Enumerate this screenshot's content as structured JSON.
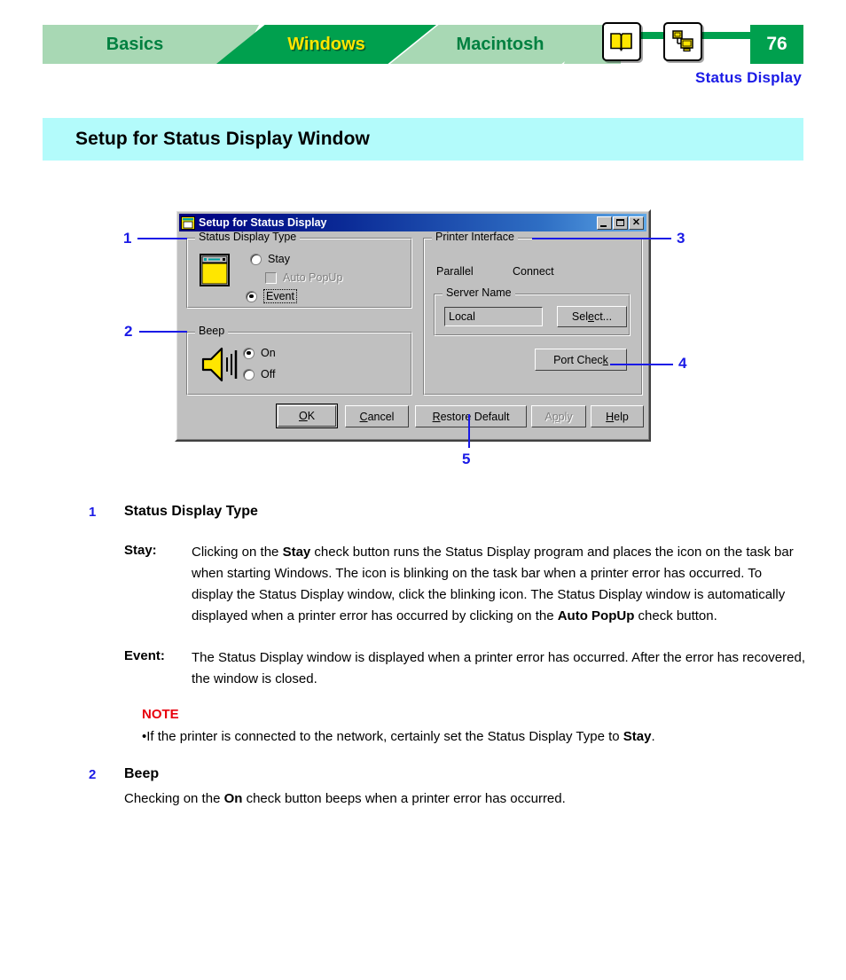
{
  "header": {
    "tabs": [
      {
        "label": "Basics",
        "active": false
      },
      {
        "label": "Windows",
        "active": true
      },
      {
        "label": "Macintosh",
        "active": false
      }
    ],
    "icons": [
      {
        "name": "book-icon",
        "label": "Book"
      },
      {
        "name": "network-printer-icon",
        "label": "Network"
      }
    ],
    "page_number": "76",
    "section_label": "Status Display",
    "colors": {
      "tab_active_bg": "#00a04e",
      "tab_active_text": "#ffe600",
      "tab_inactive_bg": "#a8d8b4",
      "tab_inactive_text": "#008040",
      "accent_blue": "#1a1ae6",
      "note_red": "#e8000d",
      "banner_bg": "#b3fbfb"
    }
  },
  "page_title": "Setup for Status Display Window",
  "dialog": {
    "title": "Setup for Status Display",
    "title_icon": "printer-window-icon",
    "titlebar_buttons": {
      "minimize": "_",
      "maximize": "□",
      "close": "✕"
    },
    "status_display_type": {
      "group_label": "Status Display Type",
      "icon": "yellow-window-icon",
      "options": [
        {
          "label": "Stay",
          "type": "radio",
          "checked": false,
          "disabled": false,
          "focused": false
        },
        {
          "label": "Auto PopUp",
          "type": "checkbox",
          "checked": false,
          "disabled": true,
          "focused": false
        },
        {
          "label": "Event",
          "type": "radio",
          "checked": true,
          "disabled": false,
          "focused": true
        }
      ]
    },
    "beep": {
      "group_label": "Beep",
      "icon": "speaker-icon",
      "options": [
        {
          "label": "On",
          "type": "radio",
          "checked": true
        },
        {
          "label": "Off",
          "type": "radio",
          "checked": false
        }
      ]
    },
    "printer_interface": {
      "group_label": "Printer Interface",
      "port_label": "Parallel",
      "connect_label": "Connect",
      "server_name": {
        "group_label": "Server Name",
        "value": "Local",
        "select_button": {
          "pre": "Sel",
          "acc": "e",
          "post": "ct..."
        }
      },
      "port_check_button": {
        "pre": "Port Chec",
        "acc": "k",
        "post": ""
      }
    },
    "buttons": [
      {
        "pre": "",
        "acc": "O",
        "post": "K",
        "default": true,
        "disabled": false,
        "name": "ok-button"
      },
      {
        "pre": "",
        "acc": "C",
        "post": "ancel",
        "default": false,
        "disabled": false,
        "name": "cancel-button"
      },
      {
        "pre": "",
        "acc": "R",
        "post": "estore Default",
        "default": false,
        "disabled": false,
        "name": "restore-default-button"
      },
      {
        "pre": "A",
        "acc": "p",
        "post": "ply",
        "default": false,
        "disabled": true,
        "name": "apply-button"
      },
      {
        "pre": "",
        "acc": "H",
        "post": "elp",
        "default": false,
        "disabled": false,
        "name": "help-button"
      }
    ]
  },
  "callouts": [
    {
      "number": "1",
      "target": "status-display-type-group"
    },
    {
      "number": "2",
      "target": "beep-group"
    },
    {
      "number": "3",
      "target": "printer-interface-group"
    },
    {
      "number": "4",
      "target": "port-check-button"
    },
    {
      "number": "5",
      "target": "restore-default-button"
    }
  ],
  "sections": [
    {
      "number": "1",
      "heading": "Status Display Type",
      "terms": [
        {
          "term": "Stay:",
          "text_html": "Clicking on the <b>Stay</b> check button runs the Status Display program and places the icon on the task bar when starting Windows. The icon is blinking on the task bar when a printer error has occurred. To display the Status Display window, click the blinking icon. The Status Display window is automatically displayed when a printer error has occurred by clicking on the <b>Auto PopUp</b> check button."
        },
        {
          "term": "Event:",
          "text_html": "The Status Display window is displayed when a printer error has occurred. After the error has recovered, the window is closed."
        }
      ],
      "note": {
        "label": "NOTE",
        "bullet": "•",
        "text_html": "If the printer is connected to the network, certainly set the Status Display Type to <b>Stay</b>."
      }
    },
    {
      "number": "2",
      "heading": "Beep",
      "text_html": "Checking on the <b>On</b> check button beeps when a printer error has occurred."
    }
  ]
}
